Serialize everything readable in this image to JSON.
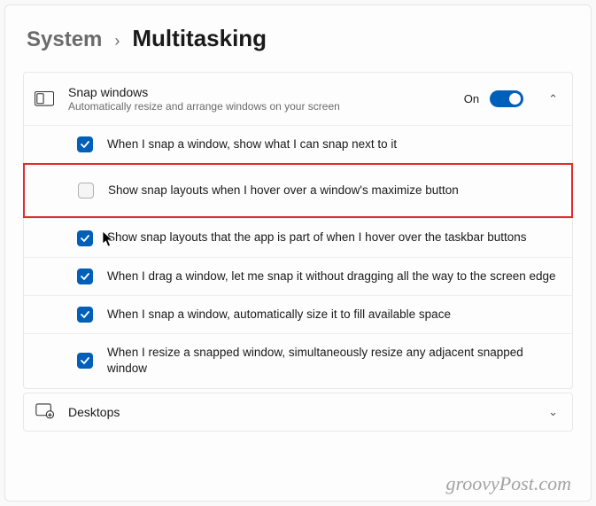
{
  "breadcrumb": {
    "parent": "System",
    "sep": "›",
    "current": "Multitasking"
  },
  "snap": {
    "title": "Snap windows",
    "subtitle": "Automatically resize and arrange windows on your screen",
    "toggle_label": "On",
    "chevron": "⌃",
    "options": [
      "When I snap a window, show what I can snap next to it",
      "Show snap layouts when I hover over a window's maximize button",
      "Show snap layouts that the app is part of when I hover over the taskbar buttons",
      "When I drag a window, let me snap it without dragging all the way to the screen edge",
      "When I snap a window, automatically size it to fill available space",
      "When I resize a snapped window, simultaneously resize any adjacent snapped window"
    ]
  },
  "desktops": {
    "title": "Desktops",
    "chevron": "⌄"
  },
  "watermark": "groovyPost.com"
}
